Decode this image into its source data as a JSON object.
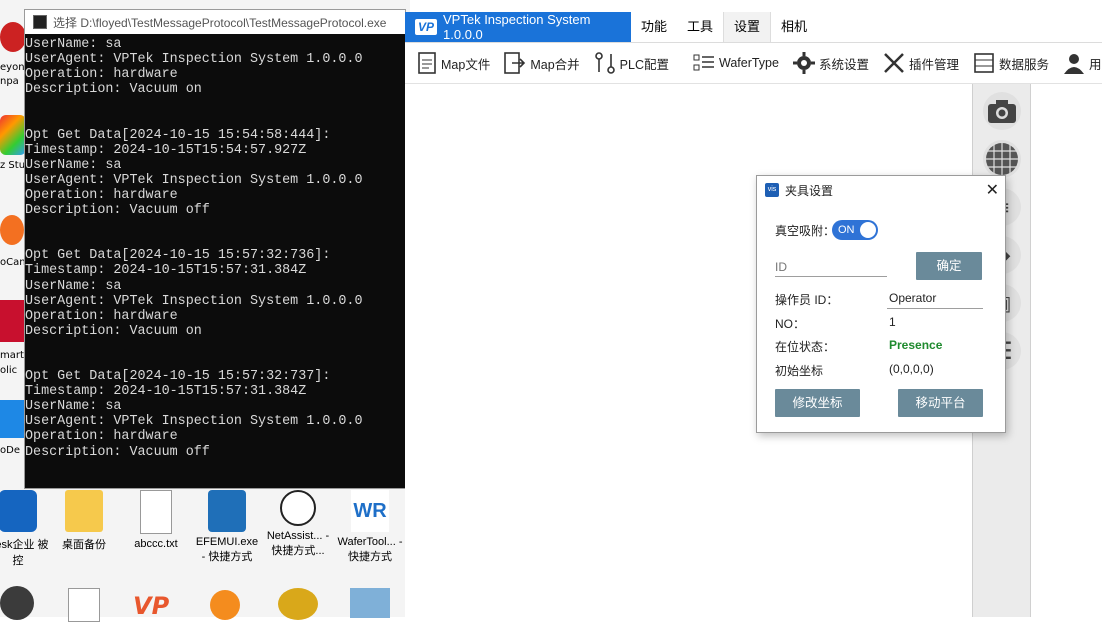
{
  "console": {
    "title": "选择 D:\\floyed\\TestMessageProtocol\\TestMessageProtocol.exe",
    "lines": [
      "UserName: sa",
      "UserAgent: VPTek Inspection System 1.0.0.0",
      "Operation: hardware",
      "Description: Vacuum on",
      "",
      "",
      "Opt Get Data[2024-10-15 15:54:58:444]:",
      "Timestamp: 2024-10-15T15:54:57.927Z",
      "UserName: sa",
      "UserAgent: VPTek Inspection System 1.0.0.0",
      "Operation: hardware",
      "Description: Vacuum off",
      "",
      "",
      "Opt Get Data[2024-10-15 15:57:32:736]:",
      "Timestamp: 2024-10-15T15:57:31.384Z",
      "UserName: sa",
      "UserAgent: VPTek Inspection System 1.0.0.0",
      "Operation: hardware",
      "Description: Vacuum on",
      "",
      "",
      "Opt Get Data[2024-10-15 15:57:32:737]:",
      "Timestamp: 2024-10-15T15:57:31.384Z",
      "UserName: sa",
      "UserAgent: VPTek Inspection System 1.0.0.0",
      "Operation: hardware",
      "Description: Vacuum off"
    ]
  },
  "desktop": {
    "icons": [
      {
        "label": "Desk企业 被控"
      },
      {
        "label": "桌面备份"
      },
      {
        "label": "abccc.txt"
      },
      {
        "label": "EFEMUI.exe - 快捷方式"
      },
      {
        "label": "NetAssist... - 快捷方式..."
      },
      {
        "label": "WaferTool... - 快捷方式"
      }
    ],
    "left_fragments": [
      "eyon",
      "npa",
      "z Stu",
      "oCan",
      "mart",
      "olic",
      "oDe"
    ]
  },
  "app": {
    "brand_logo": "VP",
    "brand_title": "VPTek Inspection System 1.0.0.0",
    "menu": [
      "功能",
      "工具",
      "设置",
      "相机"
    ],
    "active_menu": "设置",
    "toolbar": [
      "Map文件",
      "Map合并",
      "PLC配置",
      "WaferType",
      "系统设置",
      "插件管理",
      "数据服务",
      "用户管理"
    ]
  },
  "dialog": {
    "title": "夹具设置",
    "icon_text": "vis",
    "close": "✕",
    "vacuum_label": "真空吸附：",
    "vacuum_state": "ON",
    "id_placeholder": "ID",
    "confirm_button": "确定",
    "operator_label": "操作员 ID：",
    "operator_value": "Operator",
    "no_label": "NO：",
    "no_value": "1",
    "presence_label": "在位状态：",
    "presence_value": "Presence",
    "coord_label": "初始坐标",
    "coord_value": "(0,0,0,0)",
    "modify_button": "修改坐标",
    "move_button": "移动平台",
    "colors": {
      "presence": "#1f8a2e",
      "button": "#6a8a9a",
      "toggle": "#2f73d6"
    }
  }
}
